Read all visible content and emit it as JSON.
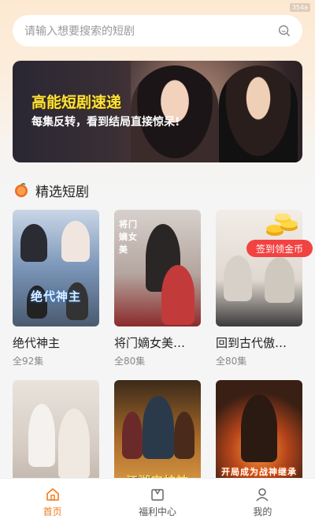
{
  "status": {
    "corner_label": "354a"
  },
  "search": {
    "placeholder": "请输入想要搜索的短剧"
  },
  "banner": {
    "title": "高能短剧速递",
    "subtitle": "每集反转，看到结局直接惊呆!"
  },
  "section": {
    "title": "精选短剧"
  },
  "coin_badge": {
    "label": "签到领金币"
  },
  "dramas": [
    {
      "title": "绝代神主",
      "episodes": "全92集",
      "poster_text": "绝代神主",
      "poster_color": "#6f8fb5"
    },
    {
      "title": "将门嫡女美…",
      "episodes": "全80集",
      "poster_text": "将门嫡女美",
      "poster_color": "#b8a8a0"
    },
    {
      "title": "回到古代傲…",
      "episodes": "全80集",
      "poster_text": "",
      "poster_color": "#e8e2dc"
    },
    {
      "title": "",
      "episodes": "",
      "poster_text": "",
      "poster_color": "#d9d2cc"
    },
    {
      "title": "",
      "episodes": "",
      "poster_text": "江湖守护神",
      "poster_color": "#8a5a2a"
    },
    {
      "title": "",
      "episodes": "",
      "poster_text": "开局成为战神继承人",
      "poster_color": "#3a1f14"
    }
  ],
  "tabbar": {
    "items": [
      {
        "label": "首页",
        "icon": "home-icon",
        "active": true
      },
      {
        "label": "福利中心",
        "icon": "gift-icon",
        "active": false
      },
      {
        "label": "我的",
        "icon": "user-icon",
        "active": false
      }
    ],
    "accent_color": "#f07a1b"
  }
}
